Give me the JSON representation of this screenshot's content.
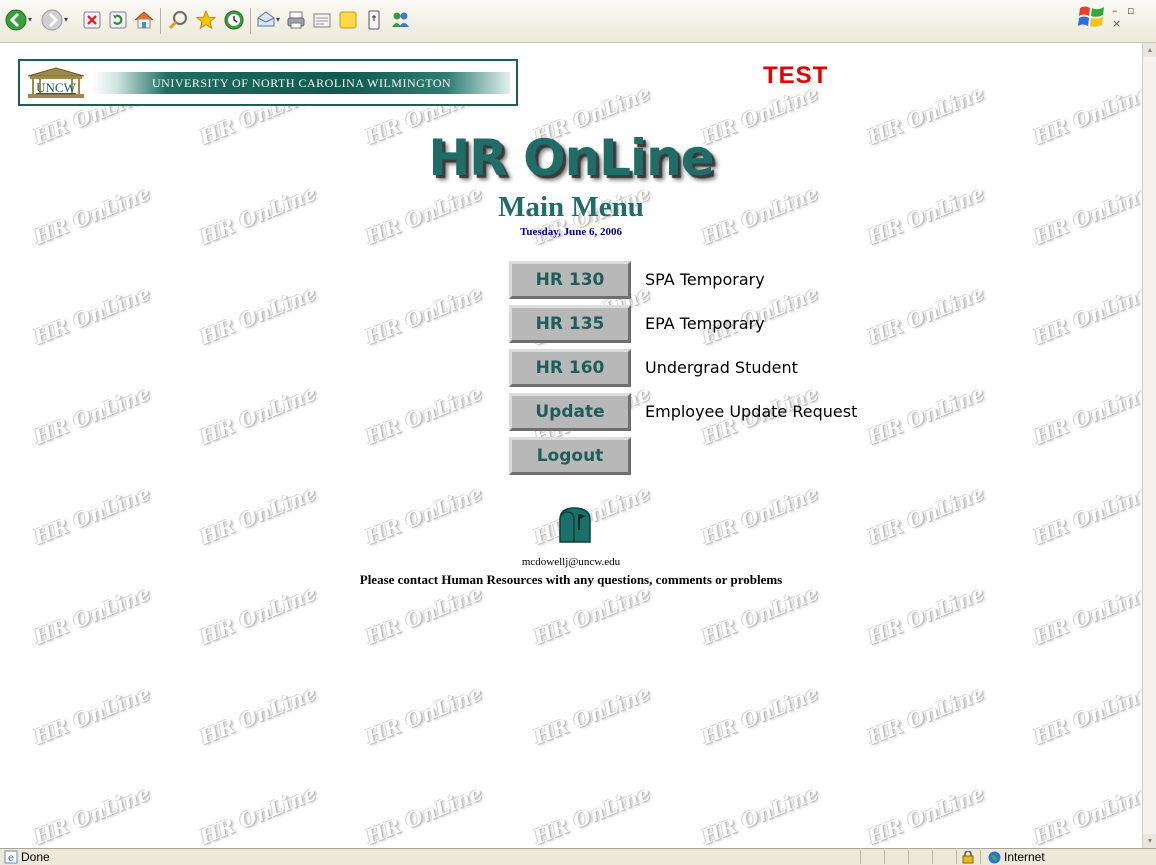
{
  "toolbar": {
    "icons": [
      "back-icon",
      "forward-icon",
      "stop-icon",
      "refresh-icon",
      "home-icon",
      "search-icon",
      "favorites-icon",
      "history-icon",
      "mail-icon",
      "print-icon",
      "edit-icon",
      "discuss-icon",
      "research-icon",
      "messenger-icon"
    ],
    "window_controls": "– ▫ ×"
  },
  "banner": {
    "logo_text": "UNCW",
    "title": "UNIVERSITY OF NORTH CAROLINA WILMINGTON"
  },
  "test_label": "TEST",
  "page": {
    "title": "HR OnLine",
    "subtitle": "Main Menu",
    "date": "Tuesday, June 6, 2006",
    "watermark": "HR OnLine"
  },
  "menu": [
    {
      "button": "HR 130",
      "label": "SPA Temporary"
    },
    {
      "button": "HR 135",
      "label": "EPA Temporary"
    },
    {
      "button": "HR 160",
      "label": "Undergrad Student"
    },
    {
      "button": "Update",
      "label": "Employee Update Request"
    },
    {
      "button": "Logout",
      "label": ""
    }
  ],
  "contact": {
    "email": "mcdowellj@uncw.edu",
    "message": "Please contact Human Resources with any questions, comments or problems"
  },
  "status": {
    "left": "Done",
    "zone": "Internet"
  },
  "colors": {
    "accent_teal": "#1f6d66",
    "test_red": "#e60000",
    "date_blue": "#00008b"
  }
}
